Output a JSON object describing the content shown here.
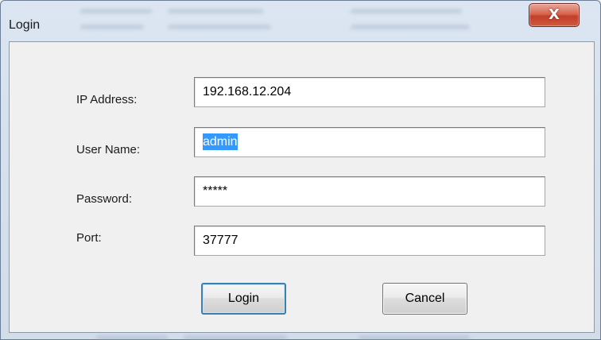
{
  "window": {
    "title": "Login",
    "close_label": "X"
  },
  "form": {
    "ip_address": {
      "label": "IP Address:",
      "value": "192.168.12.204"
    },
    "user_name": {
      "label": "User Name:",
      "value": "admin"
    },
    "password": {
      "label": "Password:",
      "value": "*****"
    },
    "port": {
      "label": "Port:",
      "value": "37777"
    }
  },
  "buttons": {
    "login_label": "Login",
    "cancel_label": "Cancel"
  }
}
